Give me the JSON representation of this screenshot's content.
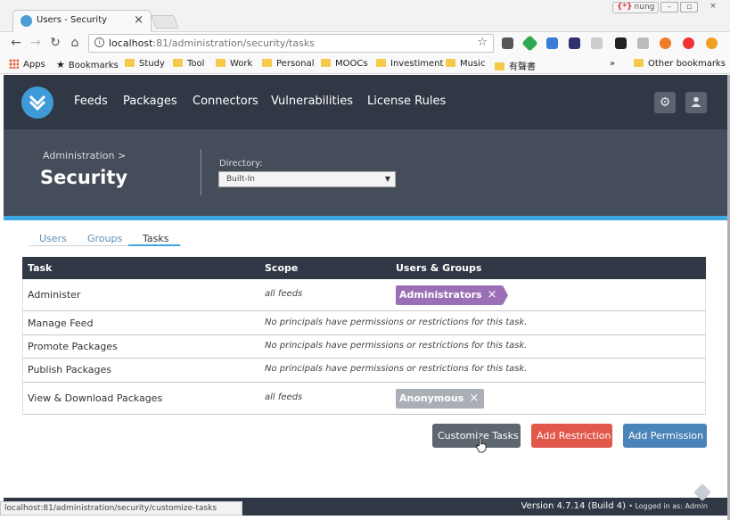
{
  "browser": {
    "tab_title": "Users - Security",
    "tab_close": "×",
    "user_label": "nung",
    "user_symbol": "{*}",
    "window_buttons": [
      "–",
      "▫",
      "×"
    ],
    "url_host": "localhost",
    "url_path": ":81/administration/security/tasks",
    "bookmarks": [
      "Apps",
      "Bookmarks",
      "Study",
      "Tool",
      "Work",
      "Personal",
      "MOOCs",
      "Investiment",
      "Music",
      "有聲書"
    ],
    "bookmarks_more": "»",
    "other_bookmarks": "Other bookmarks"
  },
  "header": {
    "nav": [
      "Feeds",
      "Packages",
      "Connectors",
      "Vulnerabilities",
      "License Rules"
    ],
    "settings_icon": "⚙",
    "user_icon": "👤"
  },
  "admin": {
    "breadcrumb": "Administration >",
    "title": "Security",
    "directory_label": "Directory:",
    "directory_value": "Built-In"
  },
  "subtabs": [
    "Users",
    "Groups",
    "Tasks"
  ],
  "table": {
    "headers": [
      "Task",
      "Scope",
      "Users & Groups"
    ],
    "rows": [
      {
        "task": "Administer",
        "scope": "all feeds",
        "principal": "Administrators"
      },
      {
        "task": "Manage Feed",
        "scope": "No principals have permissions or restrictions for this task."
      },
      {
        "task": "Promote Packages",
        "scope": "No principals have permissions or restrictions for this task."
      },
      {
        "task": "Publish Packages",
        "scope": "No principals have permissions or restrictions for this task."
      },
      {
        "task": "View & Download Packages",
        "scope": "all feeds",
        "principal": "Anonymous"
      }
    ],
    "remove_symbol": "×"
  },
  "buttons": {
    "customize": "Customize Tasks",
    "add_restriction": "Add Restriction",
    "add_permission": "Add Permission"
  },
  "footer": {
    "status_url": "localhost:81/administration/security/customize-tasks",
    "version": "Version 4.7.14 (Build 4)",
    "logged_in": "• Logged in as: Admin"
  }
}
